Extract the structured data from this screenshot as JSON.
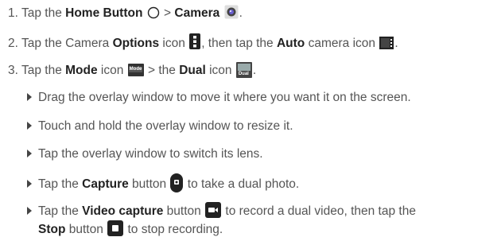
{
  "steps": {
    "s1": {
      "num": "1.",
      "a": "Tap the ",
      "b1": "Home Button",
      "c": " > ",
      "b2": "Camera",
      "d": "."
    },
    "s2": {
      "num": "2.",
      "a": "Tap the Camera ",
      "b1": "Options",
      "c": " icon ",
      "d": ", then tap the ",
      "b2": "Auto",
      "e": " camera icon ",
      "f": "."
    },
    "s3": {
      "num": "3.",
      "a": "Tap the ",
      "b1": "Mode",
      "c": " icon ",
      "icon_text1": "Mode",
      "d": " > the ",
      "b2": "Dual",
      "e": " icon ",
      "icon_text2": "Dual",
      "f": "."
    }
  },
  "bullets": {
    "b1": "Drag the overlay window to move it where you want it on the screen.",
    "b2": "Touch and hold the overlay window to resize it.",
    "b3": "Tap the overlay window to switch its lens.",
    "b4": {
      "a": "Tap the ",
      "b": "Capture",
      "c": " button ",
      "d": " to take a dual photo."
    },
    "b5": {
      "a": "Tap the ",
      "b": "Video capture",
      "c": " button ",
      "d": " to record a dual video, then tap the"
    },
    "b5_cont": {
      "b": "Stop",
      "c": " button ",
      "d": " to stop recording."
    }
  },
  "icons": [
    "home-button-icon",
    "camera-app-icon",
    "options-menu-icon",
    "auto-camera-icon",
    "mode-icon",
    "dual-icon",
    "capture-button-icon",
    "video-capture-icon",
    "stop-button-icon"
  ]
}
